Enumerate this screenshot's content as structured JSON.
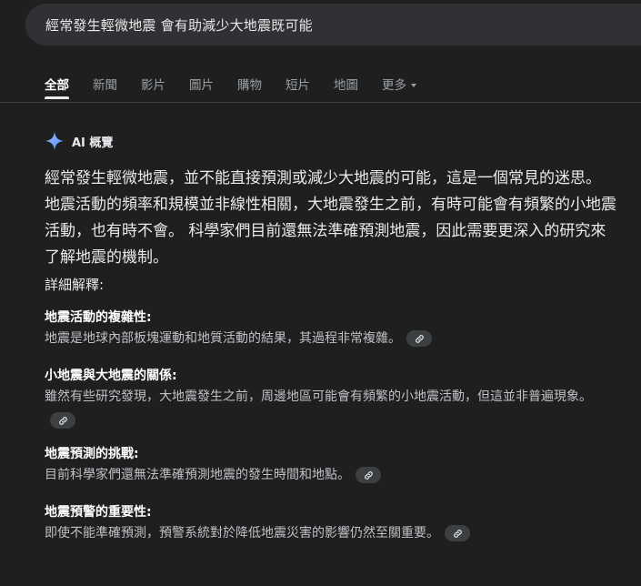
{
  "search": {
    "query": "經常發生輕微地震 會有助減少大地震既可能"
  },
  "tabs": [
    {
      "label": "全部"
    },
    {
      "label": "新聞"
    },
    {
      "label": "影片"
    },
    {
      "label": "圖片"
    },
    {
      "label": "購物"
    },
    {
      "label": "短片"
    },
    {
      "label": "地圖"
    },
    {
      "label": "更多"
    }
  ],
  "ai_overview": {
    "title": "AI 概覽",
    "summary": "經常發生輕微地震，並不能直接預測或減少大地震的可能，這是一個常見的迷思。 地震活動的頻率和規模並非線性相關，大地震發生之前，有時可能會有頻繁的小地震活動，也有時不會。 科學家們目前還無法準確預測地震，因此需要更深入的研究來了解地震的機制。",
    "details_heading": "詳細解釋:",
    "items": [
      {
        "title": "地震活動的複雜性:",
        "desc": "地震是地球內部板塊運動和地質活動的結果，其過程非常複雜。"
      },
      {
        "title": "小地震與大地震的關係:",
        "desc": "雖然有些研究發現，大地震發生之前，周邊地區可能會有頻繁的小地震活動，但這並非普遍現象。"
      },
      {
        "title": "地震預測的挑戰:",
        "desc": "目前科學家們還無法準確預測地震的發生時間和地點。"
      },
      {
        "title": "地震預警的重要性:",
        "desc": "即使不能準確預測，預警系統對於降低地震災害的影響仍然至關重要。"
      }
    ]
  },
  "colors": {
    "background": "#1f1f1f",
    "searchbar": "#303134",
    "accent_star": "#8ab4f8"
  }
}
